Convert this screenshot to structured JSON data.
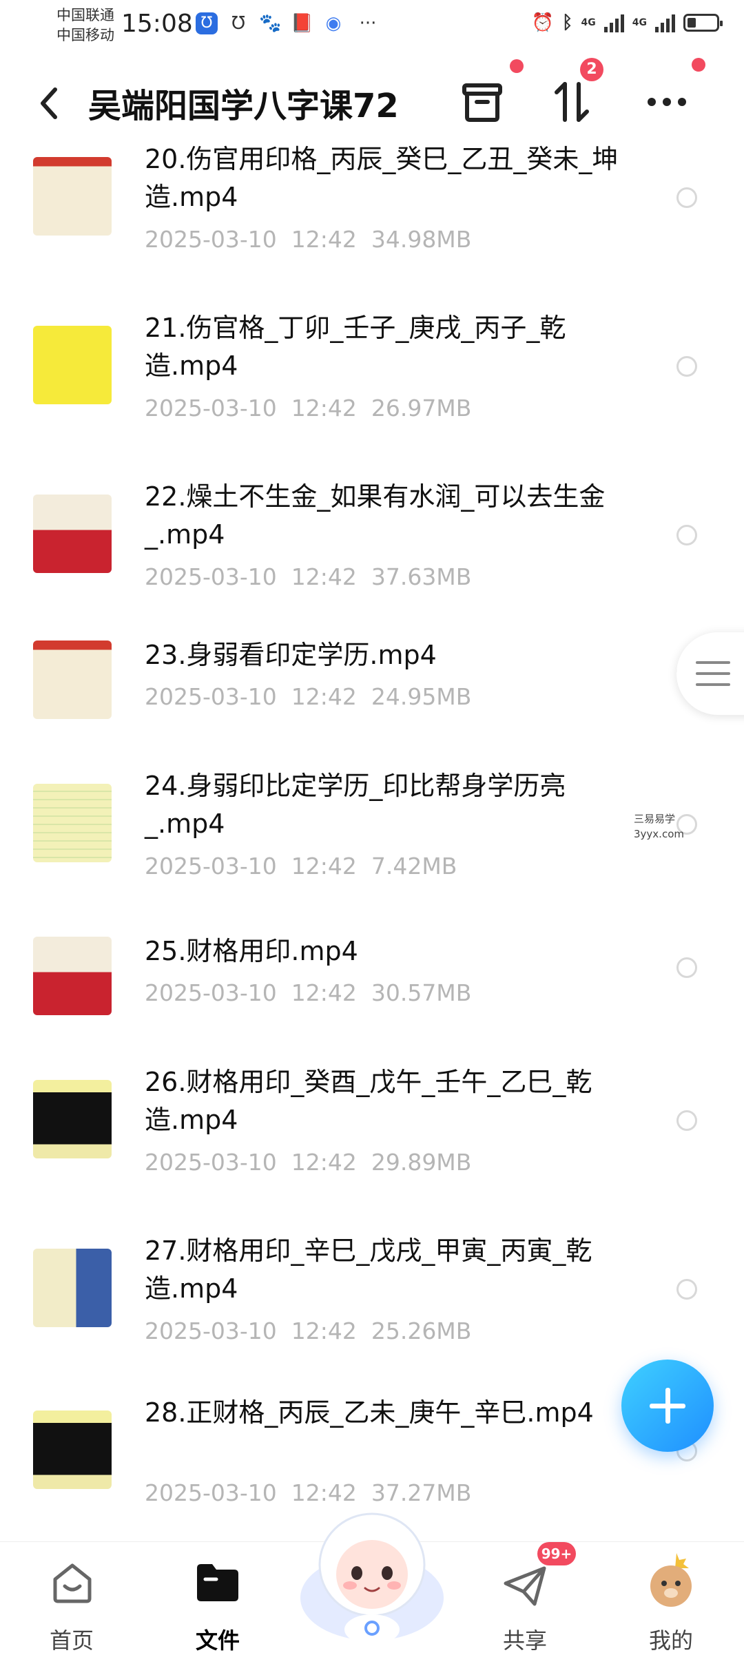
{
  "status_bar": {
    "carrier1": "中国联通",
    "carrier2": "中国移动",
    "time": "15:08",
    "net1": "4G",
    "net2": "4G",
    "battery_level": 0.3,
    "app_icons": [
      "hollow-u-icon",
      "u-icon",
      "paw-icon",
      "book-icon",
      "compass-icon"
    ],
    "more": "···"
  },
  "header": {
    "title": "吴端阳国学八字课72",
    "transfer_badge": "2",
    "accent": "#f24a5f"
  },
  "files": [
    {
      "name": "20.伤官用印格_丙辰_癸巳_乙丑_癸未_坤造.mp4",
      "date": "2025-03-10  12:42",
      "size": "34.98MB",
      "thumb": "chart-sheet"
    },
    {
      "name": "21.伤官格_丁卯_壬子_庚戌_丙子_乾造.mp4",
      "date": "2025-03-10  12:42",
      "size": "26.97MB",
      "thumb": "yellow-notes"
    },
    {
      "name": "22.燥土不生金_如果有水润_可以去生金_.mp4",
      "date": "2025-03-10  12:42",
      "size": "37.63MB",
      "thumb": "red-sheet"
    },
    {
      "name": "23.身弱看印定学历.mp4",
      "date": "2025-03-10  12:42",
      "size": "24.95MB",
      "thumb": "chart-sheet"
    },
    {
      "name": "24.身弱印比定学历_印比帮身学历亮_.mp4",
      "date": "2025-03-10  12:42",
      "size": "7.42MB",
      "thumb": "yellow-table"
    },
    {
      "name": "25.财格用印.mp4",
      "date": "2025-03-10  12:42",
      "size": "30.57MB",
      "thumb": "red-sheet"
    },
    {
      "name": "26.财格用印_癸酉_戊午_壬午_乙巳_乾造.mp4",
      "date": "2025-03-10  12:42",
      "size": "29.89MB",
      "thumb": "dark-notes"
    },
    {
      "name": "27.财格用印_辛巳_戊戌_甲寅_丙寅_乾造.mp4",
      "date": "2025-03-10  12:42",
      "size": "25.26MB",
      "thumb": "qr-sheet"
    },
    {
      "name": "28.正财格_丙辰_乙未_庚午_辛巳.mp4",
      "date": "2025-03-10  12:42",
      "size": "37.27MB",
      "thumb": "dark-notes"
    }
  ],
  "watermark": {
    "line1": "三易易学",
    "line2": "3yyx.com"
  },
  "tabbar": {
    "home": "首页",
    "files": "文件",
    "share": "共享",
    "share_badge": "99+",
    "mine": "我的"
  }
}
